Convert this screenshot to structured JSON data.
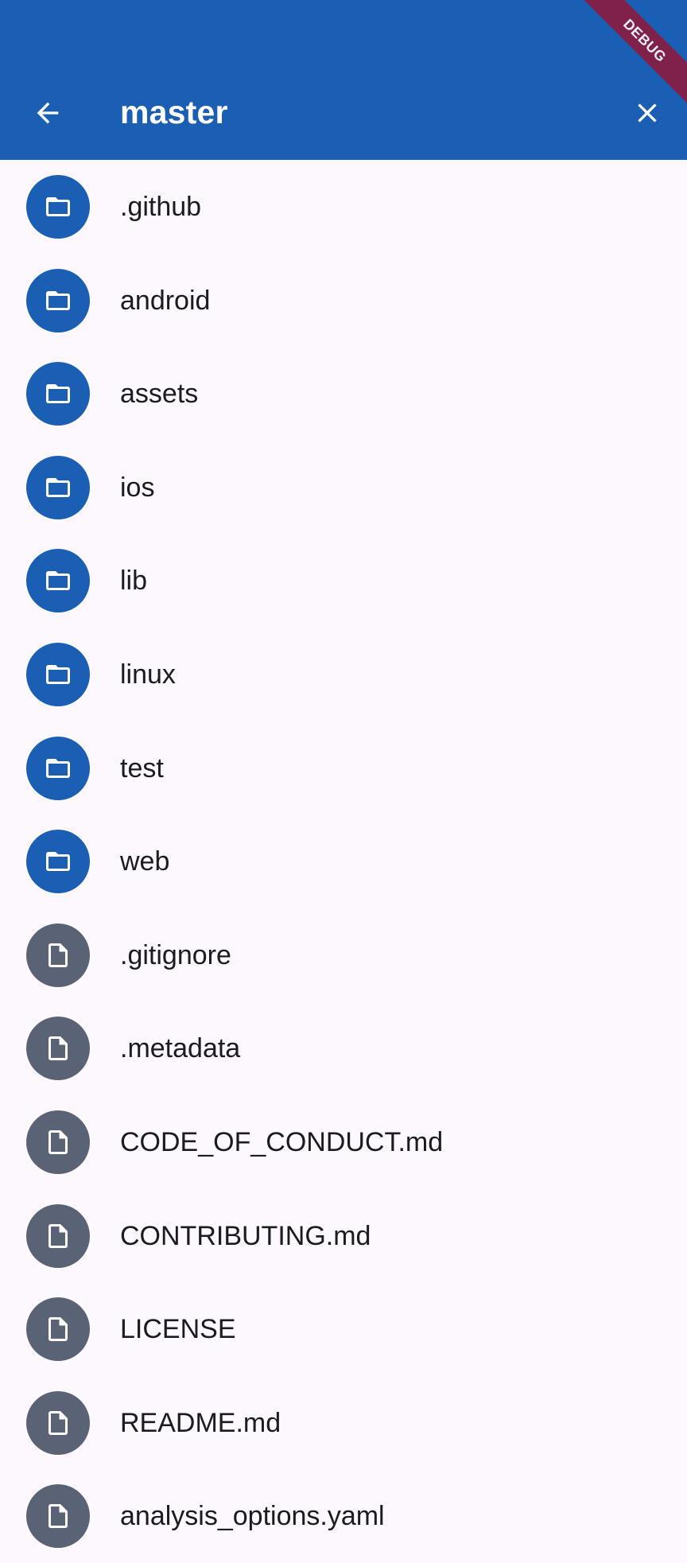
{
  "app_bar": {
    "title": "master",
    "back_icon": "arrow-left-icon",
    "close_icon": "close-icon",
    "color": "#1a5fb4"
  },
  "debug_banner": {
    "label": "DEBUG",
    "color": "#8c1b3f"
  },
  "entries": [
    {
      "name": ".github",
      "type": "folder",
      "icon": "folder-icon"
    },
    {
      "name": "android",
      "type": "folder",
      "icon": "folder-icon"
    },
    {
      "name": "assets",
      "type": "folder",
      "icon": "folder-icon"
    },
    {
      "name": "ios",
      "type": "folder",
      "icon": "folder-icon"
    },
    {
      "name": "lib",
      "type": "folder",
      "icon": "folder-icon"
    },
    {
      "name": "linux",
      "type": "folder",
      "icon": "folder-icon"
    },
    {
      "name": "test",
      "type": "folder",
      "icon": "folder-icon"
    },
    {
      "name": "web",
      "type": "folder",
      "icon": "folder-icon"
    },
    {
      "name": ".gitignore",
      "type": "file",
      "icon": "file-icon"
    },
    {
      "name": ".metadata",
      "type": "file",
      "icon": "file-icon"
    },
    {
      "name": "CODE_OF_CONDUCT.md",
      "type": "file",
      "icon": "file-icon"
    },
    {
      "name": "CONTRIBUTING.md",
      "type": "file",
      "icon": "file-icon"
    },
    {
      "name": "LICENSE",
      "type": "file",
      "icon": "file-icon"
    },
    {
      "name": "README.md",
      "type": "file",
      "icon": "file-icon"
    },
    {
      "name": "analysis_options.yaml",
      "type": "file",
      "icon": "file-icon"
    }
  ],
  "colors": {
    "folder": "#1a5fb4",
    "file": "#5a6275",
    "background": "#fcf8fd"
  }
}
